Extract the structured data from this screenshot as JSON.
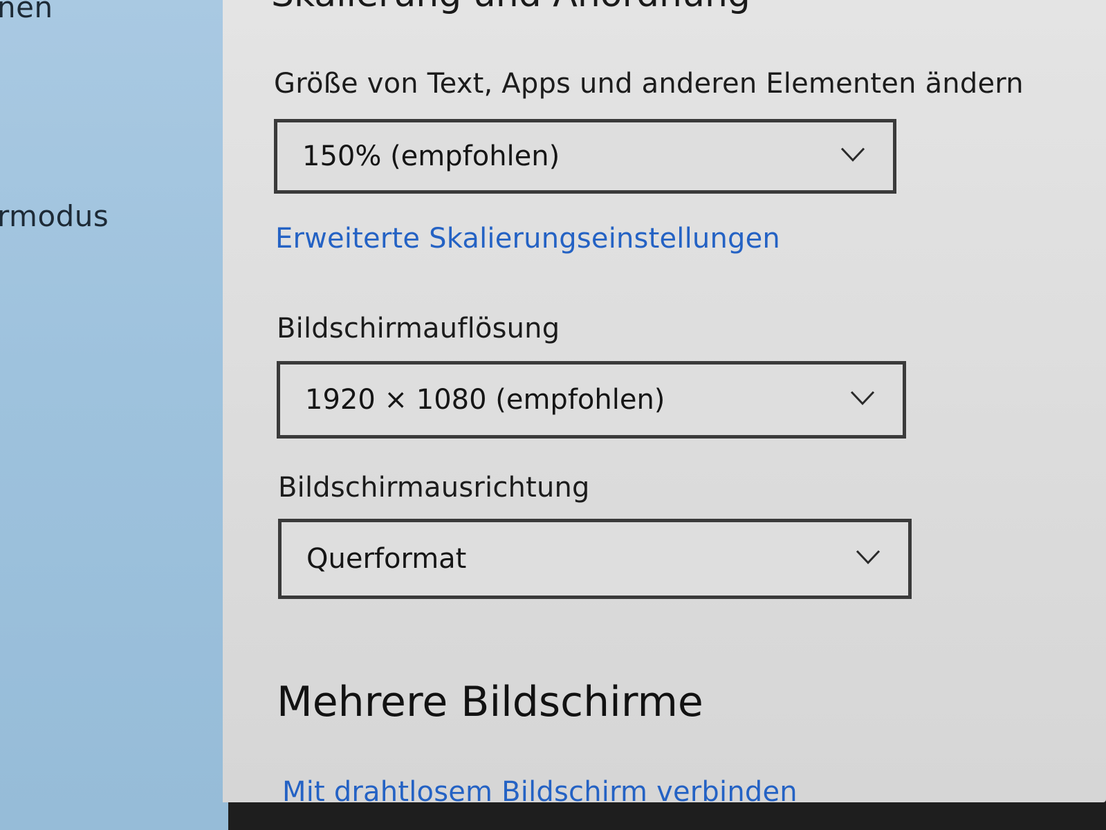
{
  "sidebar": {
    "items": [
      {
        "label": "nen"
      },
      {
        "label": "rmodus"
      }
    ]
  },
  "content": {
    "section_title": "Skalierung und Anordnung",
    "scale": {
      "label": "Größe von Text, Apps und anderen Elementen ändern",
      "value": "150% (empfohlen)"
    },
    "advanced_scaling_link": "Erweiterte Skalierungseinstellungen",
    "resolution": {
      "label": "Bildschirmauflösung",
      "value": "1920 × 1080 (empfohlen)"
    },
    "orientation": {
      "label": "Bildschirmausrichtung",
      "value": "Querformat"
    },
    "multi_display": {
      "title": "Mehrere Bildschirme",
      "wireless_link": "Mit drahtlosem Bildschirm verbinden"
    }
  },
  "icons": {
    "dropdown": "chevron-down-icon"
  },
  "colors": {
    "sidebar_bg": "#a9c9e2",
    "content_bg": "#e0e0e0",
    "link": "#2462c4",
    "select_border": "#3a3a3a"
  }
}
